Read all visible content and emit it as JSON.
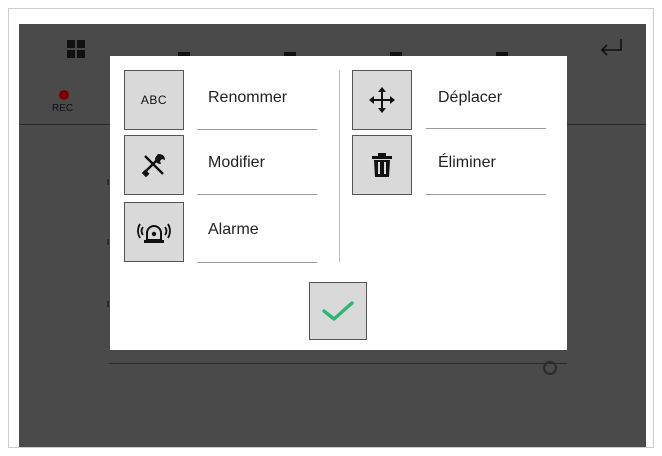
{
  "header": {
    "grid_icon": "grid-icon",
    "back_icon": "return-arrow-icon",
    "rec_label": "REC"
  },
  "menu": {
    "left_items": [
      {
        "icon": "abc-text-icon",
        "icon_text": "ABC",
        "label": "Renommer"
      },
      {
        "icon": "wrench-screwdriver-icon",
        "label": "Modifier"
      },
      {
        "icon": "alarm-siren-icon",
        "label": "Alarme"
      }
    ],
    "right_items": [
      {
        "icon": "move-arrows-icon",
        "label": "Déplacer"
      },
      {
        "icon": "trash-icon",
        "label": "Éliminer"
      }
    ],
    "confirm_icon": "checkmark-icon"
  },
  "colors": {
    "overlay_bg": "#4a4a4a",
    "dialog_bg": "#ffffff",
    "button_bg": "#d9d9d9",
    "check_green": "#2bb673",
    "rec_dot": "#7a0000"
  }
}
